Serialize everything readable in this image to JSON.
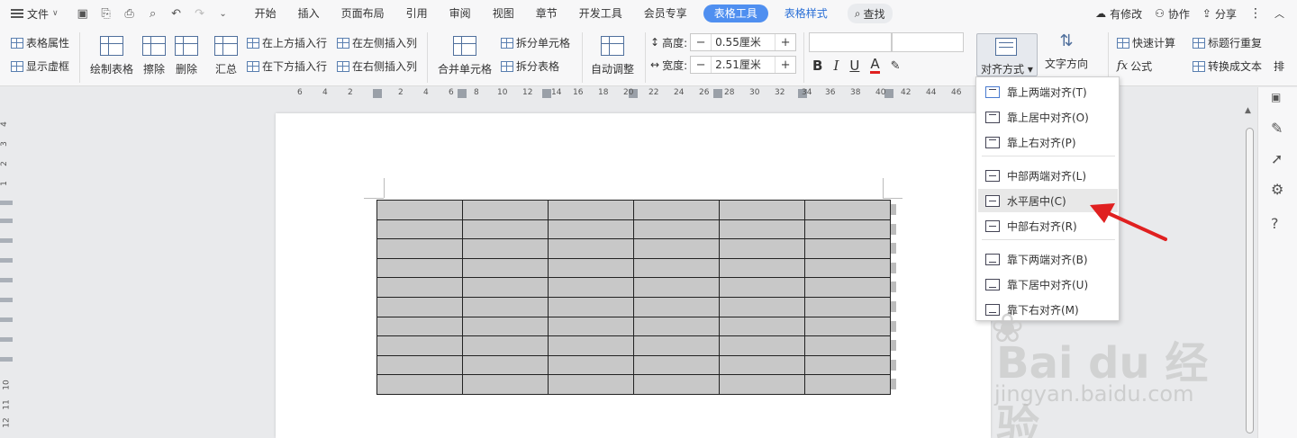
{
  "menubar": {
    "file": "文件",
    "tabs": [
      "开始",
      "插入",
      "页面布局",
      "引用",
      "审阅",
      "视图",
      "章节",
      "开发工具",
      "会员专享"
    ],
    "active_tab": "表格工具",
    "second_tab": "表格样式",
    "search": "查找",
    "right": {
      "changes": "有修改",
      "collab": "协作",
      "share": "分享"
    }
  },
  "ribbon": {
    "table_props": "表格属性",
    "show_grid": "显示虚框",
    "draw_table": "绘制表格",
    "erase": "擦除",
    "delete": "删除",
    "summary": "汇总",
    "insert_above": "在上方插入行",
    "insert_below": "在下方插入行",
    "insert_left": "在左侧插入列",
    "insert_right": "在右侧插入列",
    "merge": "合并单元格",
    "split_cell": "拆分单元格",
    "split_table": "拆分表格",
    "auto_adjust": "自动调整",
    "height_label": "高度:",
    "height_value": "0.55厘米",
    "width_label": "宽度:",
    "width_value": "2.51厘米",
    "minus": "−",
    "plus": "+",
    "bold": "B",
    "italic": "I",
    "underline": "U",
    "font_color": "A",
    "align_label": "对齐方式",
    "text_direction": "文字方向",
    "quick_calc": "快速计算",
    "formula": "公式",
    "formula_fx": "fx",
    "header_repeat": "标题行重复",
    "convert_text": "转换成文本",
    "sort_partial": "排"
  },
  "ruler": {
    "h_ticks": [
      "6",
      "4",
      "2",
      "2",
      "4",
      "6",
      "8",
      "10",
      "12",
      "14",
      "16",
      "18",
      "20",
      "22",
      "24",
      "26",
      "28",
      "30",
      "32",
      "34",
      "36",
      "38",
      "40",
      "42",
      "44",
      "46"
    ],
    "v_ticks": [
      "4",
      "3",
      "2",
      "1",
      "10",
      "11",
      "12"
    ]
  },
  "table": {
    "rows": 10,
    "cols": 6
  },
  "dropdown": {
    "items": [
      {
        "label": "靠上两端对齐(T)",
        "v": "top"
      },
      {
        "label": "靠上居中对齐(O)",
        "v": "top"
      },
      {
        "label": "靠上右对齐(P)",
        "v": "top"
      },
      {
        "label": "中部两端对齐(L)",
        "v": "mid"
      },
      {
        "label": "水平居中(C)",
        "v": "mid"
      },
      {
        "label": "中部右对齐(R)",
        "v": "mid"
      },
      {
        "label": "靠下两端对齐(B)",
        "v": "bot"
      },
      {
        "label": "靠下居中对齐(U)",
        "v": "bot"
      },
      {
        "label": "靠下右对齐(M)",
        "v": "bot"
      }
    ],
    "selected_index": 0,
    "hover_index": 4
  },
  "watermark": {
    "brand": "Bai du 经验",
    "url": "jingyan.baidu.com"
  },
  "colors": {
    "accent": "#4f8ff0",
    "arrow": "#e02020",
    "cell": "#c8c8c8"
  }
}
